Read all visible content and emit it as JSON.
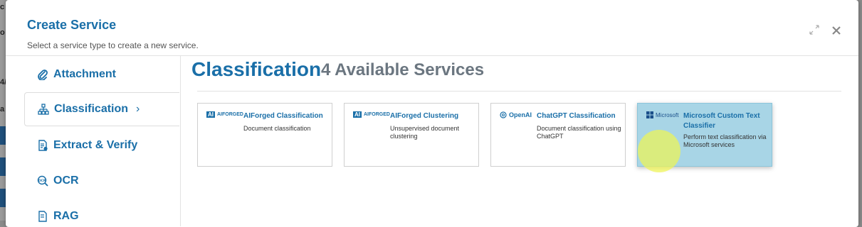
{
  "background": {
    "fragments": [
      "c",
      "o",
      "4/",
      "a"
    ]
  },
  "modal": {
    "title": "Create Service",
    "subtitle": "Select a service type to create a new service."
  },
  "sidebar": {
    "items": [
      {
        "label": "Attachment",
        "icon": "paperclip-icon",
        "active": false
      },
      {
        "label": "Classification",
        "icon": "hierarchy-icon",
        "active": true,
        "chevron": "›"
      },
      {
        "label": "Extract & Verify",
        "icon": "document-verify-icon",
        "active": false
      },
      {
        "label": "OCR",
        "icon": "ocr-icon",
        "active": false
      },
      {
        "label": "RAG",
        "icon": "rag-icon",
        "active": false
      }
    ]
  },
  "content": {
    "title": "Classification",
    "count": "4 Available Services"
  },
  "services": [
    {
      "logo": "AIFORGED",
      "title": "AIForged Classification",
      "desc": "Document classification"
    },
    {
      "logo": "AIFORGED",
      "title": "AIForged Clustering",
      "desc": "Unsupervised document clustering"
    },
    {
      "logo": "OpenAI",
      "title": "ChatGPT Classification",
      "desc": "Document classification using ChatGPT"
    },
    {
      "logo": "Microsoft",
      "title": "Microsoft Custom Text Classifier",
      "desc": "Perform text classification via Microsoft services",
      "hover": true
    }
  ],
  "colors": {
    "accent": "#1a6fa8",
    "muted": "#6b7680",
    "card_hover": "#a8d5e6",
    "cursor_highlight": "#f0f550"
  }
}
